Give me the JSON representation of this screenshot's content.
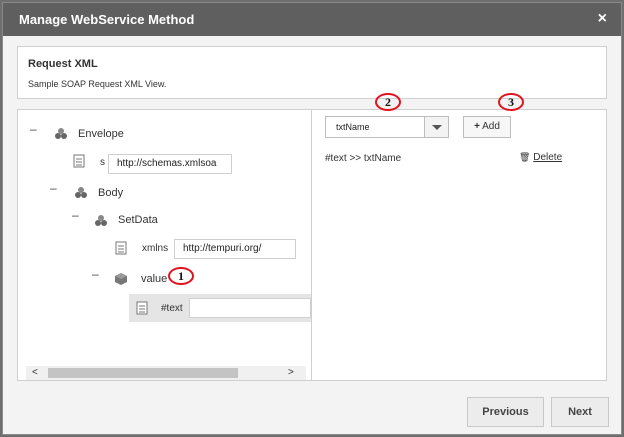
{
  "dialog": {
    "title": "Manage WebService Method",
    "close_glyph": "×"
  },
  "info": {
    "title": "Request XML",
    "subtitle": "Sample SOAP Request XML View."
  },
  "tree": {
    "envelope": {
      "label": "Envelope",
      "attr_name": "s",
      "attr_value": "http://schemas.xmlsoa"
    },
    "body": {
      "label": "Body"
    },
    "setdata": {
      "label": "SetData",
      "attr_name": "xmlns",
      "attr_value": "http://tempuri.org/"
    },
    "value": {
      "label": "value"
    },
    "text_node": {
      "label": "#text",
      "value": ""
    },
    "dash": "–"
  },
  "scroll": {
    "left": "<",
    "right": ">"
  },
  "right_panel": {
    "select_value": "txtName",
    "add_label": "Add",
    "add_glyph": "+",
    "mapping": "#text >> txtName",
    "delete_label": "Delete",
    "delete_glyph": "🗑"
  },
  "markers": [
    "1",
    "2",
    "3"
  ],
  "footer": {
    "previous": "Previous",
    "next": "Next"
  }
}
